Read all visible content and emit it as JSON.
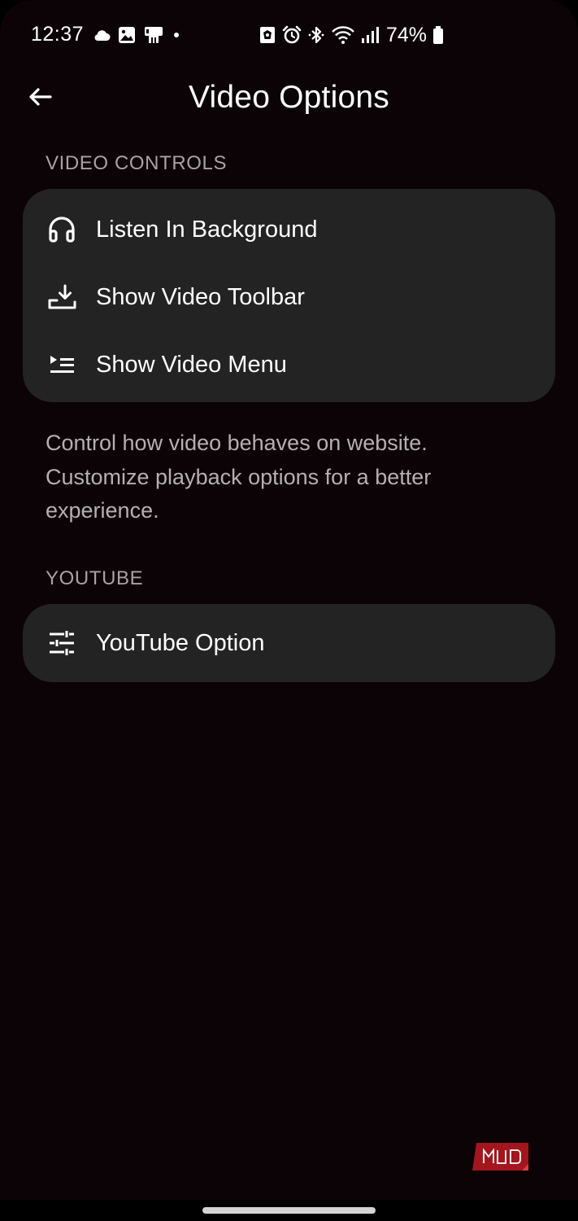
{
  "status_bar": {
    "time": "12:37",
    "battery_percent": "74%",
    "left_icons": [
      "cloud-icon",
      "gallery-icon",
      "phone-clean-icon",
      "dot-icon"
    ],
    "right_icons": [
      "shield-icon",
      "alarm-icon",
      "bluetooth-icon",
      "wifi-icon",
      "signal-icon",
      "battery-icon"
    ]
  },
  "header": {
    "title": "Video Options",
    "back_icon": "back-arrow-icon"
  },
  "video_controls": {
    "section_label": "VIDEO CONTROLS",
    "items": [
      {
        "label": "Listen In Background",
        "icon": "headphones-icon"
      },
      {
        "label": "Show Video Toolbar",
        "icon": "download-tray-icon"
      },
      {
        "label": "Show Video Menu",
        "icon": "playlist-play-icon"
      }
    ],
    "description": "Control how video behaves on website. Customize playback options for a better experience."
  },
  "youtube": {
    "section_label": "YOUTUBE",
    "items": [
      {
        "label": "YouTube Option",
        "icon": "sliders-icon"
      }
    ]
  },
  "watermark": {
    "text": "MUO"
  },
  "colors": {
    "background": "#0b0306",
    "card": "#232323",
    "section_label": "#a7a2a4",
    "description": "#b4b0b2",
    "watermark_red": "#a3161d"
  }
}
